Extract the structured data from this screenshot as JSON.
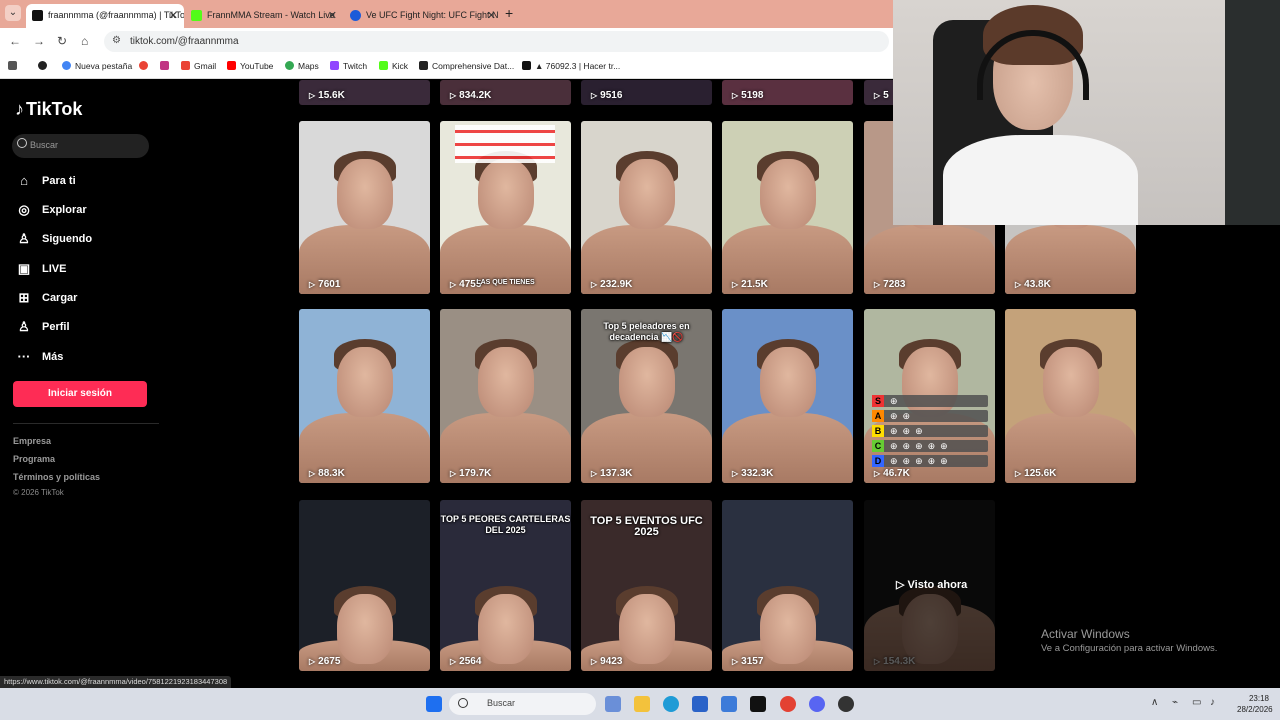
{
  "browser": {
    "tabs": [
      {
        "title": "fraannmma (@fraannmma) | TikTok",
        "color": "#111111",
        "active": true
      },
      {
        "title": "FrannMMA Stream - Watch Live",
        "color": "#53fc18",
        "active": false
      },
      {
        "title": "Ve UFC Fight Night: UFC Fight N",
        "color": "#1c5bd9",
        "active": false
      }
    ],
    "url": "tiktok.com/@fraannmma",
    "bookmarks": [
      {
        "label": "Nueva pestaña",
        "color": "#4285f4"
      },
      {
        "label": "",
        "color": "#ea4335"
      },
      {
        "label": "",
        "color": "#c13584"
      },
      {
        "label": "Gmail",
        "color": "#ea4335"
      },
      {
        "label": "YouTube",
        "color": "#ff0000"
      },
      {
        "label": "Maps",
        "color": "#34a853"
      },
      {
        "label": "Twitch",
        "color": "#9146ff"
      },
      {
        "label": "Kick",
        "color": "#53fc18"
      },
      {
        "label": "Comprehensive Dat...",
        "color": "#222222"
      },
      {
        "label": "▲ 76092.3 | Hacer tr...",
        "color": "#111111"
      }
    ]
  },
  "tiktok": {
    "logo": "TikTok",
    "search_placeholder": "Buscar",
    "nav": [
      {
        "label": "Para ti",
        "icon": "home-icon",
        "glyph": "⌂"
      },
      {
        "label": "Explorar",
        "icon": "compass-icon",
        "glyph": "◎"
      },
      {
        "label": "Siguendo",
        "icon": "following-icon",
        "glyph": "♙"
      },
      {
        "label": "LIVE",
        "icon": "live-icon",
        "glyph": "▣"
      },
      {
        "label": "Cargar",
        "icon": "upload-icon",
        "glyph": "⊞"
      },
      {
        "label": "Perfil",
        "icon": "profile-icon",
        "glyph": "♙"
      },
      {
        "label": "Más",
        "icon": "more-icon",
        "glyph": "···"
      }
    ],
    "login_button": "Iniciar sesión",
    "footer": [
      "Empresa",
      "Programa",
      "Términos y políticas"
    ],
    "copyright": "© 2026 TikTok",
    "accent_color": "#fe2c55"
  },
  "videos": {
    "row0": [
      "15.6K",
      "834.2K",
      "9516",
      "5198",
      "5"
    ],
    "row1": [
      "7601",
      "4755",
      "232.9K",
      "21.5K",
      "7283",
      "43.8K"
    ],
    "row2": [
      "88.3K",
      "179.7K",
      "137.3K",
      "332.3K",
      "46.7K",
      "125.6K"
    ],
    "row3": [
      "2675",
      "2564",
      "9423",
      "3157",
      "154.3K"
    ],
    "overlays": {
      "r1c1": "LAS QUE TIENES",
      "r2c2": "Top 5 peleadores en decadencia 📉🚫",
      "r3c1": "TOP 5 PEORES CARTELERAS DEL 2025",
      "r3c2": "TOP 5 EVENTOS UFC 2025"
    },
    "tier_labels": [
      "S",
      "A",
      "B",
      "C",
      "D"
    ],
    "watched_label": "Visto ahora"
  },
  "windows": {
    "activate_title": "Activar Windows",
    "activate_sub": "Ve a Configuración para activar Windows.",
    "status_url": "https://www.tiktok.com/@fraannmma/video/7581221923183447308",
    "taskbar_search": "Buscar",
    "time": "23:18",
    "date": "28/2/2026"
  }
}
